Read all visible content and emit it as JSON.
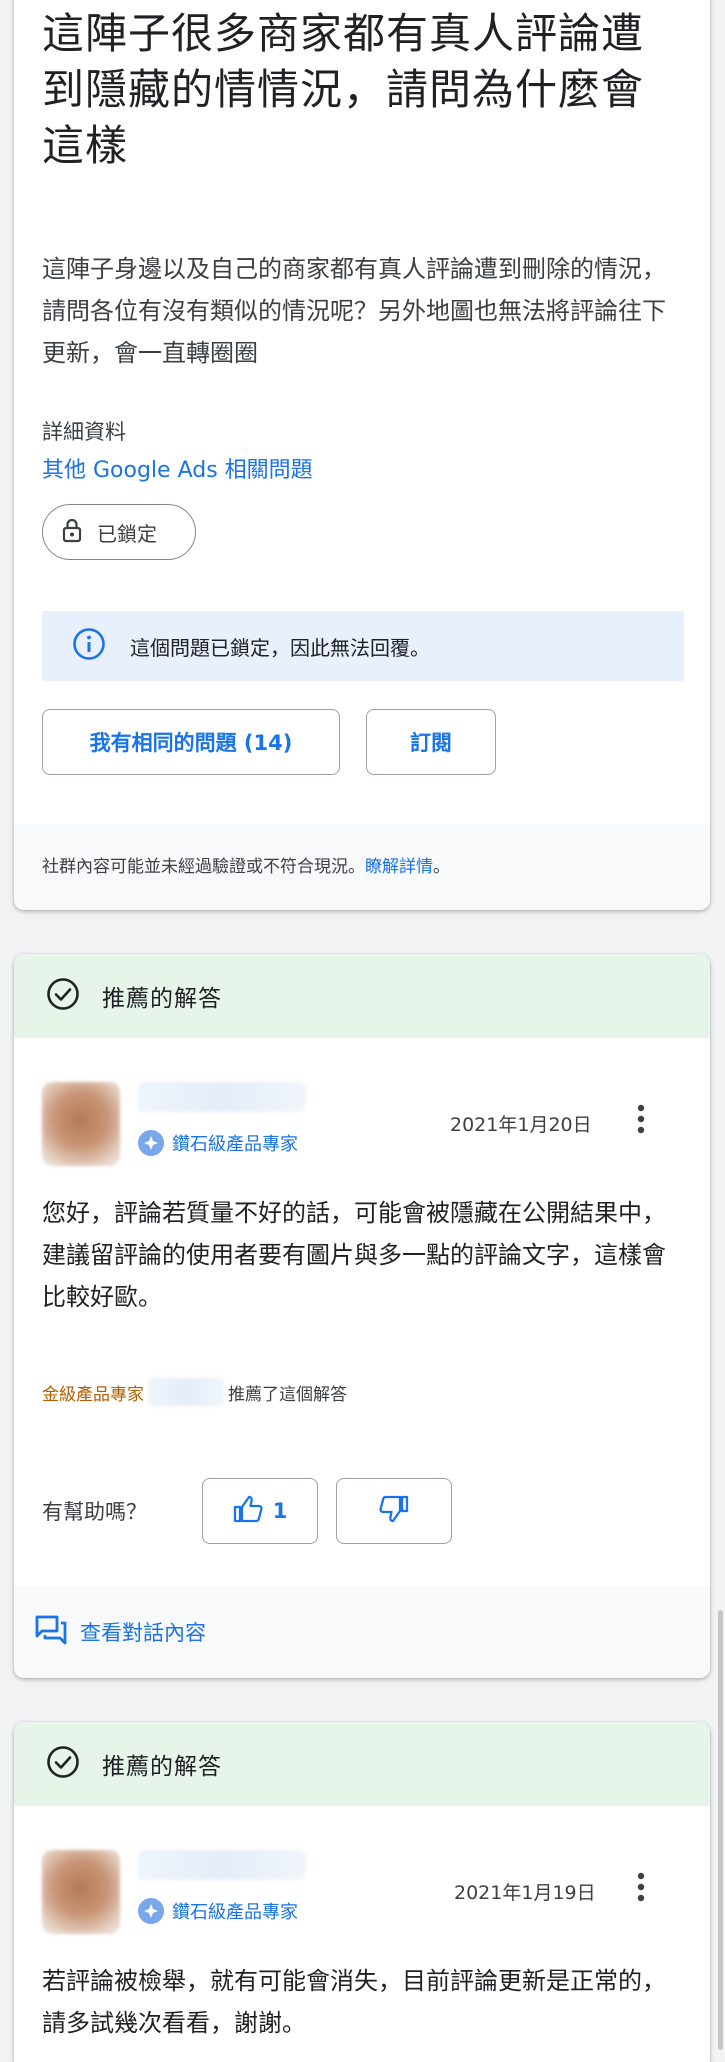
{
  "question": {
    "title": "這陣子很多商家都有真人評論遭到隱藏的情情況，請問為什麼會這樣",
    "body": "這陣子身邊以及自己的商家都有真人評論遭到刪除的情況，請問各位有沒有類似的情況呢？另外地圖也無法將評論往下更新，會一直轉圈圈",
    "details_label": "詳細資料",
    "details_link": "其他 Google Ads 相關問題",
    "lock_chip": "已鎖定",
    "locked_notice": "這個問題已鎖定，因此無法回覆。",
    "same_question_button": "我有相同的問題 (14)",
    "subscribe_button": "訂閱",
    "disclaimer": "社群內容可能並未經過驗證或不符合現況。",
    "disclaimer_link": "瞭解詳情",
    "disclaimer_end": "。"
  },
  "answers": [
    {
      "header": "推薦的解答",
      "badge": "鑽石級產品專家",
      "date": "2021年1月20日",
      "text": "您好，評論若質量不好的話，可能會被隱藏在公開結果中，建議留評論的使用者要有圖片與多一點的評論文字，這樣會比較好歐。",
      "recommender_level": "金級產品專家",
      "recommended_text": "推薦了這個解答",
      "helpful_label": "有幫助嗎？",
      "upvotes": "1",
      "view_conversation": "查看對話內容"
    },
    {
      "header": "推薦的解答",
      "badge": "鑽石級產品專家",
      "date": "2021年1月19日",
      "text": "若評論被檢舉，就有可能會消失，目前評論更新是正常的，請多試幾次看看，謝謝。"
    }
  ],
  "colors": {
    "accent": "#1a73e8",
    "recommended_bg": "#e6f4ea",
    "notice_bg": "#e8f0fe",
    "gold": "#b06000"
  },
  "icons": [
    "lock-icon",
    "info-icon",
    "check-circle-icon",
    "diamond-icon",
    "more-vert-icon",
    "thumb-up-icon",
    "thumb-down-icon",
    "forum-icon"
  ]
}
